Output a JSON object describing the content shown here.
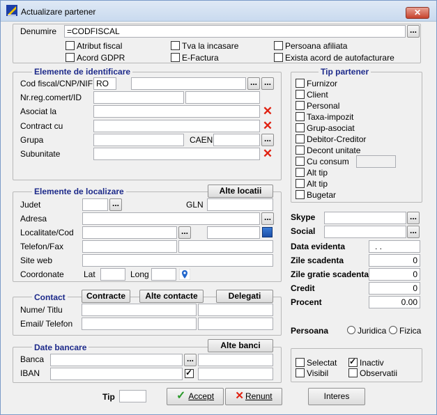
{
  "window": {
    "title": "Actualizare partener",
    "close": "✕"
  },
  "top": {
    "denumire_label": "Denumire",
    "denumire_value": "=CODFISCAL",
    "checks": [
      {
        "label": "Atribut fiscal",
        "checked": false
      },
      {
        "label": "Tva la incasare",
        "checked": false
      },
      {
        "label": "Persoana afiliata",
        "checked": false
      },
      {
        "label": "Acord GDPR",
        "checked": false
      },
      {
        "label": "E-Factura",
        "checked": false
      },
      {
        "label": "Exista acord de autofacturare",
        "checked": false
      }
    ]
  },
  "identificare": {
    "title": "Elemente de identificare",
    "cod_fiscal_label": "Cod fiscal/CNP/NIF",
    "cod_fiscal_prefix": "RO",
    "nr_reg_label": "Nr.reg.comert/ID",
    "asociat_label": "Asociat la",
    "contract_label": "Contract cu",
    "grupa_label": "Grupa",
    "caen_label": "CAEN",
    "subunitate_label": "Subunitate"
  },
  "tip_partener": {
    "title": "Tip partener",
    "items": [
      {
        "label": "Furnizor",
        "checked": false
      },
      {
        "label": "Client",
        "checked": false
      },
      {
        "label": "Personal",
        "checked": false
      },
      {
        "label": "Taxa-impozit",
        "checked": false
      },
      {
        "label": "Grup-asociat",
        "checked": false
      },
      {
        "label": "Debitor-Creditor",
        "checked": false
      },
      {
        "label": "Decont unitate",
        "checked": false
      },
      {
        "label": "Cu consum",
        "checked": false
      },
      {
        "label": "Alt tip",
        "checked": false
      },
      {
        "label": "Alt tip",
        "checked": false
      },
      {
        "label": "Bugetar",
        "checked": false
      }
    ]
  },
  "localizare": {
    "title": "Elemente de localizare",
    "alte_locatii": "Alte locatii",
    "judet_label": "Judet",
    "gln_label": "GLN",
    "adresa_label": "Adresa",
    "localitate_label": "Localitate/Cod",
    "telefon_label": "Telefon/Fax",
    "site_label": "Site web",
    "coordonate_label": "Coordonate",
    "lat_label": "Lat",
    "long_label": "Long"
  },
  "right_fields": {
    "skype_label": "Skype",
    "social_label": "Social",
    "data_evidenta_label": "Data evidenta",
    "data_evidenta_value": ". .",
    "zile_scadenta_label": "Zile scadenta",
    "zile_scadenta_value": "0",
    "zile_gratie_label": "Zile gratie scadenta",
    "zile_gratie_value": "0",
    "credit_label": "Credit",
    "credit_value": "0",
    "procent_label": "Procent",
    "procent_value": "0.00",
    "persoana_label": "Persoana",
    "juridica_label": "Juridica",
    "fizica_label": "Fizica"
  },
  "contact": {
    "title": "Contact",
    "contracte": "Contracte",
    "alte_contacte": "Alte contacte",
    "delegati": "Delegati",
    "nume_label": "Nume/ Titlu",
    "email_label": "Email/ Telefon"
  },
  "bancare": {
    "title": "Date bancare",
    "alte_banci": "Alte banci",
    "banca_label": "Banca",
    "iban_label": "IBAN"
  },
  "flags": [
    {
      "label": "Selectat",
      "checked": false
    },
    {
      "label": "Inactiv",
      "checked": true
    },
    {
      "label": "Visibil",
      "checked": false
    },
    {
      "label": "Observatii",
      "checked": false
    }
  ],
  "bottom": {
    "tip_label": "Tip",
    "accept": "Accept",
    "renunt": "Renunt",
    "interes": "Interes"
  },
  "icons": {
    "dots": "...",
    "remove": "✕",
    "accept_icon": "✓",
    "renunt_icon": "✕"
  }
}
